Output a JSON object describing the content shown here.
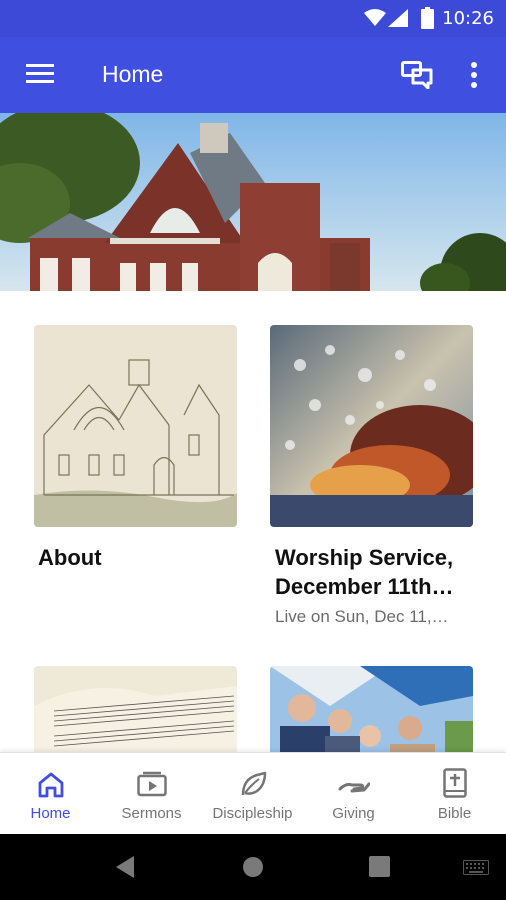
{
  "status_bar": {
    "time": "10:26"
  },
  "app_bar": {
    "title": "Home"
  },
  "cards": [
    {
      "title": "About",
      "subtitle": ""
    },
    {
      "title": "Worship Service, December 11th…",
      "subtitle": "Live on Sun, Dec 11,…"
    }
  ],
  "bottom_nav": {
    "items": [
      {
        "label": "Home",
        "icon": "home-icon",
        "active": true
      },
      {
        "label": "Sermons",
        "icon": "play-icon",
        "active": false
      },
      {
        "label": "Discipleship",
        "icon": "leaf-icon",
        "active": false
      },
      {
        "label": "Giving",
        "icon": "giving-hand-icon",
        "active": false
      },
      {
        "label": "Bible",
        "icon": "bible-icon",
        "active": false
      }
    ]
  },
  "colors": {
    "primary": "#3f4fe0",
    "status": "#3d4ad8",
    "inactive": "#757575"
  }
}
